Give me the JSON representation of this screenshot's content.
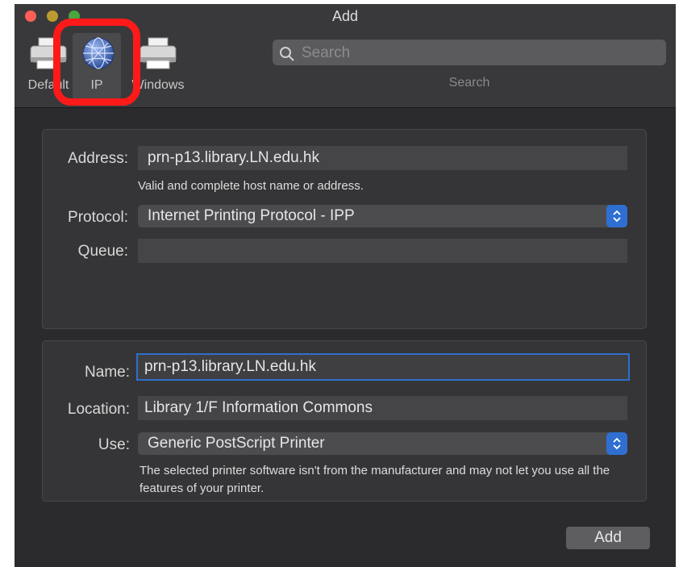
{
  "window": {
    "title": "Add"
  },
  "toolbar": {
    "items": [
      {
        "label": "Default",
        "icon": "printer-icon"
      },
      {
        "label": "IP",
        "icon": "globe-icon"
      },
      {
        "label": "Windows",
        "icon": "printer-icon"
      }
    ],
    "search": {
      "placeholder": "Search",
      "caption": "Search"
    }
  },
  "connection": {
    "address_label": "Address:",
    "address_value": "prn-p13.library.LN.edu.hk",
    "address_note": "Valid and complete host name or address.",
    "protocol_label": "Protocol:",
    "protocol_value": "Internet Printing Protocol - IPP",
    "queue_label": "Queue:",
    "queue_value": ""
  },
  "printer": {
    "name_label": "Name:",
    "name_value": "prn-p13.library.LN.edu.hk",
    "location_label": "Location:",
    "location_value": "Library 1/F Information Commons",
    "use_label": "Use:",
    "use_value": "Generic PostScript Printer",
    "use_note": "The selected printer software isn't from the manufacturer and may not let you use all the features of your printer."
  },
  "actions": {
    "add_label": "Add"
  },
  "colors": {
    "accent": "#2f6fd1",
    "highlight": "#ff1a1a",
    "background": "#2b2b2d"
  }
}
